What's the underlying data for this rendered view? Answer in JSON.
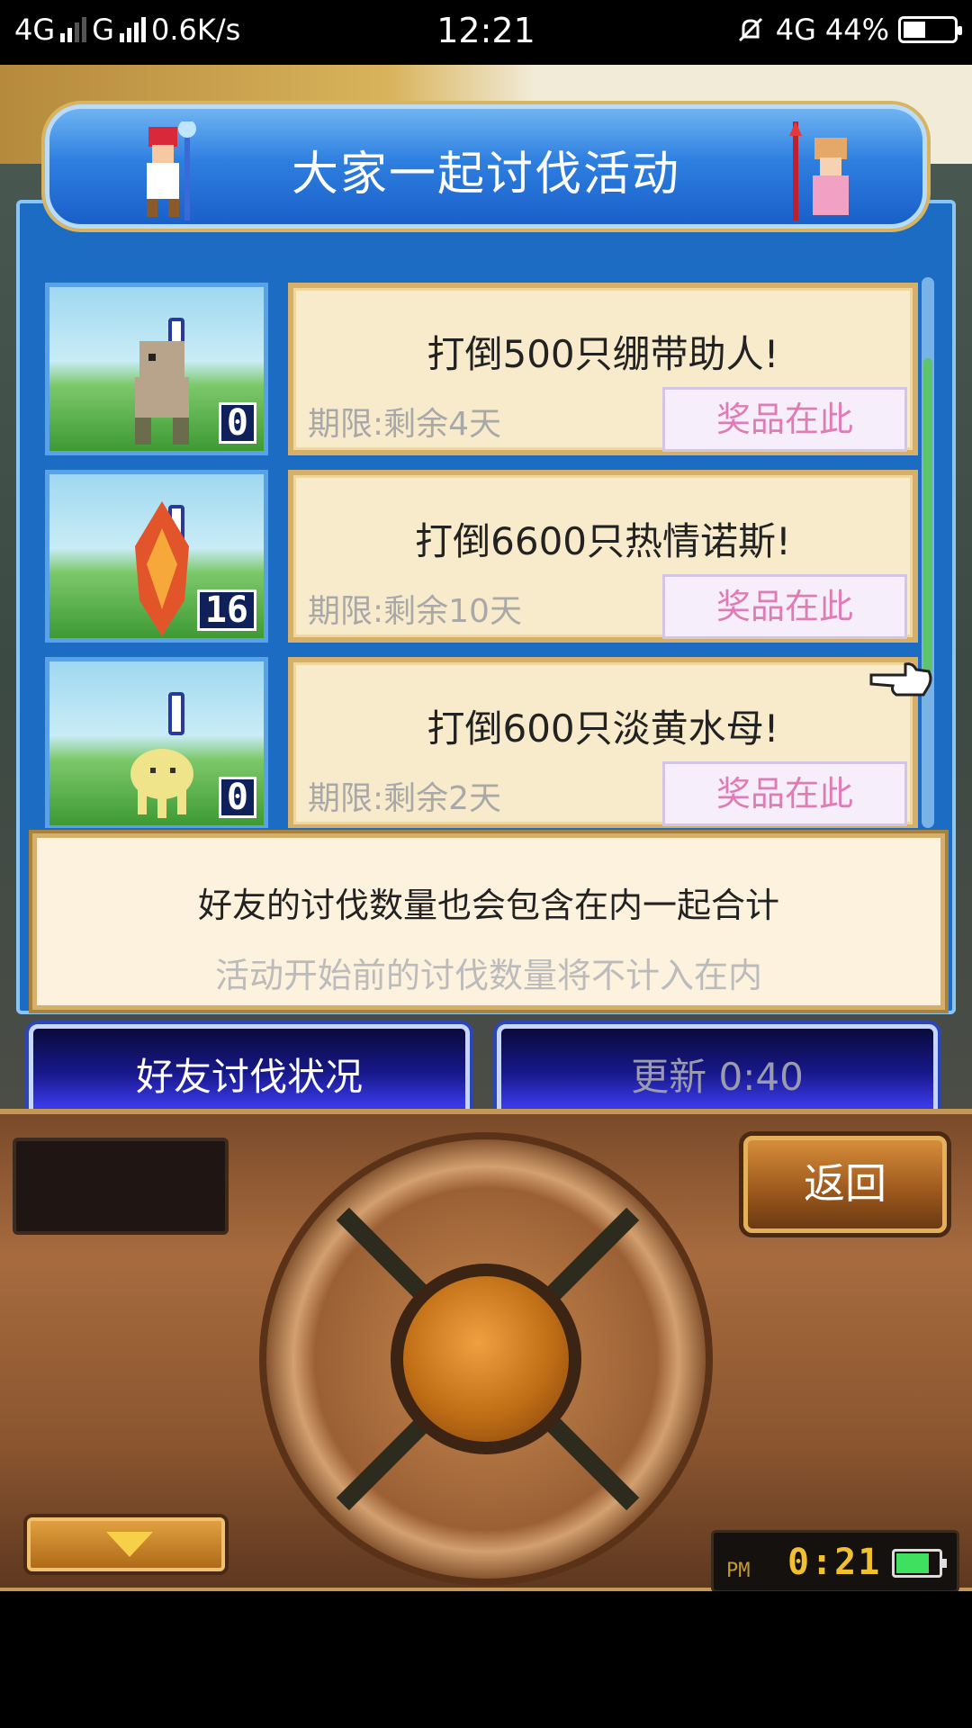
{
  "status_bar": {
    "network1": "4G",
    "network2": "G",
    "speed": "0.6K/s",
    "time": "12:21",
    "network3": "4G",
    "battery_pct": "44%",
    "battery_level": 0.44
  },
  "dialog": {
    "title": "大家一起讨伐活动",
    "missions": [
      {
        "text": "打倒500只绷带助人!",
        "deadline": "期限:剩余4天",
        "reward_label": "奖品在此",
        "count": "0",
        "monster_color": "#b8a48a"
      },
      {
        "text": "打倒6600只热情诺斯!",
        "deadline": "期限:剩余10天",
        "reward_label": "奖品在此",
        "count": "16",
        "monster_color": "#e2552a"
      },
      {
        "text": "打倒600只淡黄水母!",
        "deadline": "期限:剩余2天",
        "reward_label": "奖品在此",
        "count": "0",
        "monster_color": "#efe48a"
      }
    ],
    "info_line1": "好友的讨伐数量也会包含在内一起合计",
    "info_line2": "活动开始前的讨伐数量将不计入在内"
  },
  "buttons": {
    "friend_status": "好友讨伐状况",
    "refresh": "更新 0:40"
  },
  "controller": {
    "back_label": "返回",
    "clock_ampm": "PM",
    "clock_time": "0:21"
  }
}
